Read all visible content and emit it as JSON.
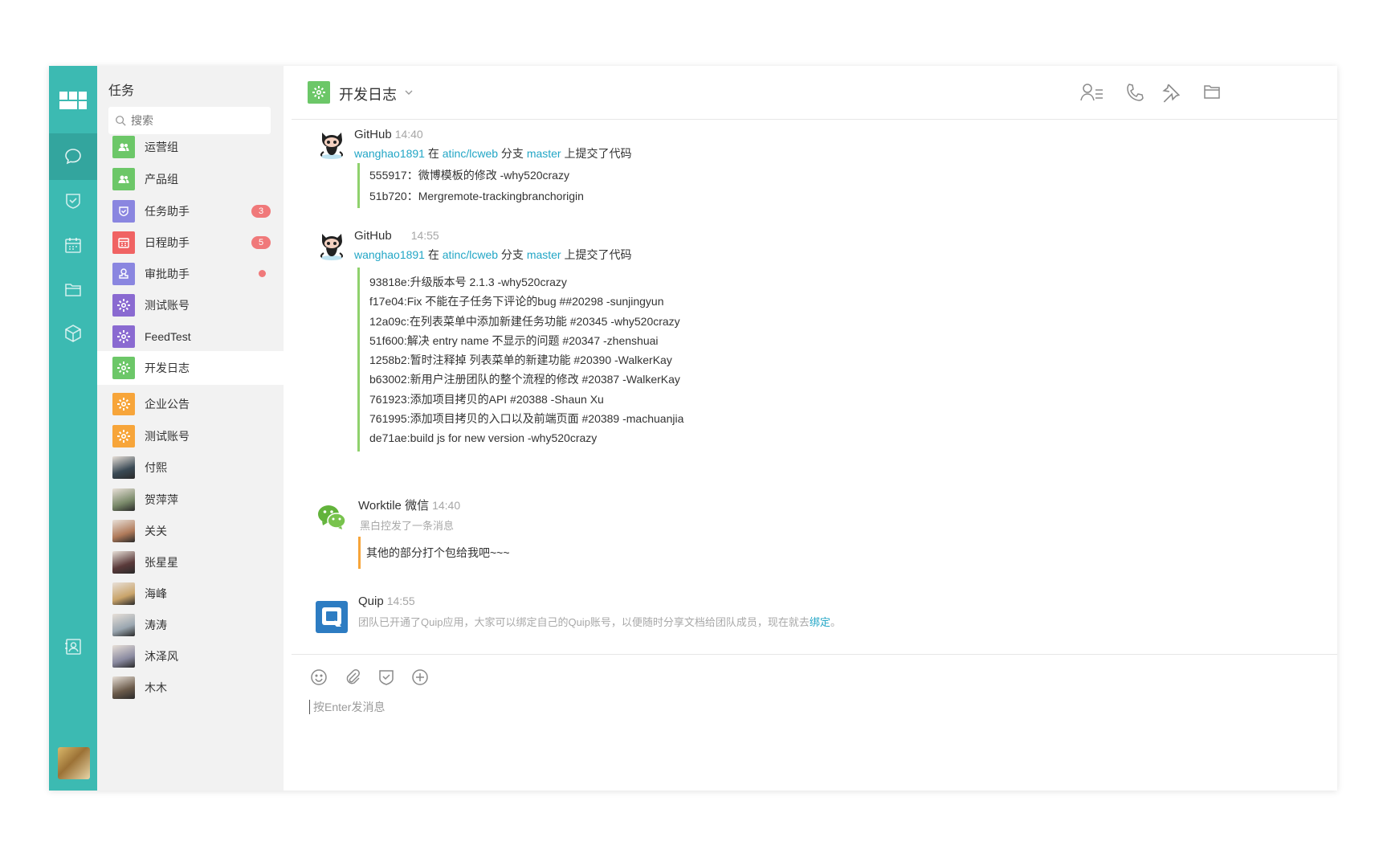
{
  "rail": {
    "items": [
      "chat-icon",
      "task-icon",
      "calendar-icon",
      "folder-icon",
      "cube-icon",
      "contacts-icon"
    ]
  },
  "list": {
    "title": "任务",
    "search_placeholder": "搜索",
    "items": [
      {
        "name": "运营组",
        "color": "#6cc768",
        "icon": "group-icon"
      },
      {
        "name": "产品组",
        "color": "#6cc768",
        "icon": "group-icon"
      },
      {
        "name": "任务助手",
        "color": "#8a86e0",
        "icon": "task-icon",
        "badge": "3"
      },
      {
        "name": "日程助手",
        "color": "#f06363",
        "icon": "calendar-icon",
        "badge": "5"
      },
      {
        "name": "审批助手",
        "color": "#8a86e0",
        "icon": "approve-icon",
        "dot": true
      },
      {
        "name": "测试账号",
        "color": "#8a6ad1",
        "icon": "gear-icon"
      },
      {
        "name": "FeedTest",
        "color": "#8a6ad1",
        "icon": "gear-icon"
      },
      {
        "name": "开发日志",
        "color": "#6cc768",
        "icon": "gear-icon",
        "active": true
      },
      {
        "name": "企业公告",
        "color": "#f7a53a",
        "icon": "gear-icon"
      },
      {
        "name": "测试账号",
        "color": "#f7a53a",
        "icon": "gear-icon"
      },
      {
        "name": "付熙",
        "avatar": "#3a4a55"
      },
      {
        "name": "贺萍萍",
        "avatar": "#7a8a6a"
      },
      {
        "name": "关关",
        "avatar": "#b07a5a"
      },
      {
        "name": "张星星",
        "avatar": "#5a3a3a"
      },
      {
        "name": "海峰",
        "avatar": "#c9a46a"
      },
      {
        "name": "涛涛",
        "avatar": "#9aa6b0"
      },
      {
        "name": "沐泽风",
        "avatar": "#8a8aa0"
      },
      {
        "name": "木木",
        "avatar": "#6a5a4a"
      }
    ]
  },
  "header": {
    "title": "开发日志",
    "actions": [
      "members-icon",
      "phone-icon",
      "pin-icon",
      "folder-icon"
    ]
  },
  "messages": [
    {
      "sender": "GitHub",
      "time": "14:40",
      "user": "wanghao1891",
      "word_at": "在",
      "repo": "atinc/lcweb",
      "word_branch": "分支",
      "branch": "master",
      "suffix": "上提交了代码",
      "commits": [
        "555917：微博模板的修改 -why520crazy",
        "51b720：Mergremote-trackingbranchorigin"
      ]
    },
    {
      "sender": "GitHub",
      "time": "14:55",
      "user": "wanghao1891",
      "word_at": "在",
      "repo": "atinc/lcweb",
      "word_branch": "分支",
      "branch": "master",
      "suffix": "上提交了代码",
      "commits": [
        "93818e:升级版本号 2.1.3 -why520crazy",
        "f17e04:Fix 不能在子任务下评论的bug ##20298 -sunjingyun",
        "12a09c:在列表菜单中添加新建任务功能 #20345 -why520crazy",
        "51f600:解决 entry name 不显示的问题 #20347 -zhenshuai",
        "1258b2:暂时注释掉 列表菜单的新建功能 #20390 -WalkerKay",
        "b63002:新用户注册团队的整个流程的修改 #20387 -WalkerKay",
        "761923:添加项目拷贝的API #20388 -Shaun Xu",
        "761995:添加项目拷贝的入口以及前端页面 #20389 -machuanjia",
        "de71ae:build js for new version -why520crazy"
      ]
    },
    {
      "sender": "Worktile 微信",
      "time": "14:40",
      "sub": "黑白控发了一条消息",
      "quote": "其他的部分打个包给我吧~~~"
    },
    {
      "sender": "Quip",
      "time": "14:55",
      "text": "团队已开通了Quip应用，大家可以绑定自己的Quip账号，以便随时分享文档给团队成员，现在就去",
      "link": "绑定",
      "end": "。"
    }
  ],
  "composer": {
    "placeholder": "按Enter发消息",
    "icons": [
      "smile-icon",
      "attachment-icon",
      "task-icon",
      "plus-icon"
    ]
  }
}
